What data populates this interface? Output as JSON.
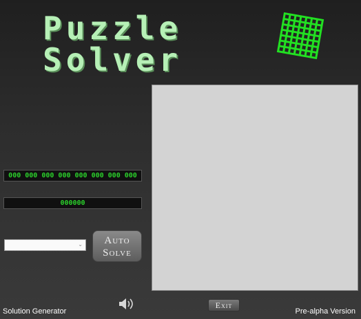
{
  "app": {
    "title_line1": "Puzzle",
    "title_line2": "Solver"
  },
  "display": {
    "code": "000 000 000 000 000 000 000 000",
    "counter": "000000"
  },
  "controls": {
    "dropdown_value": "",
    "auto_solve_line1": "Auto",
    "auto_solve_line2": "Solve",
    "exit_label": "Exit"
  },
  "footer": {
    "left": "Solution Generator",
    "right": "Pre-alpha Version"
  },
  "icons": {
    "logo": "grid-icon",
    "sound": "speaker-icon",
    "dropdown": "chevron-down-icon"
  },
  "colors": {
    "accent_green": "#2bd02b",
    "title_green": "#b6f0b6",
    "board": "#d3d3d3"
  }
}
